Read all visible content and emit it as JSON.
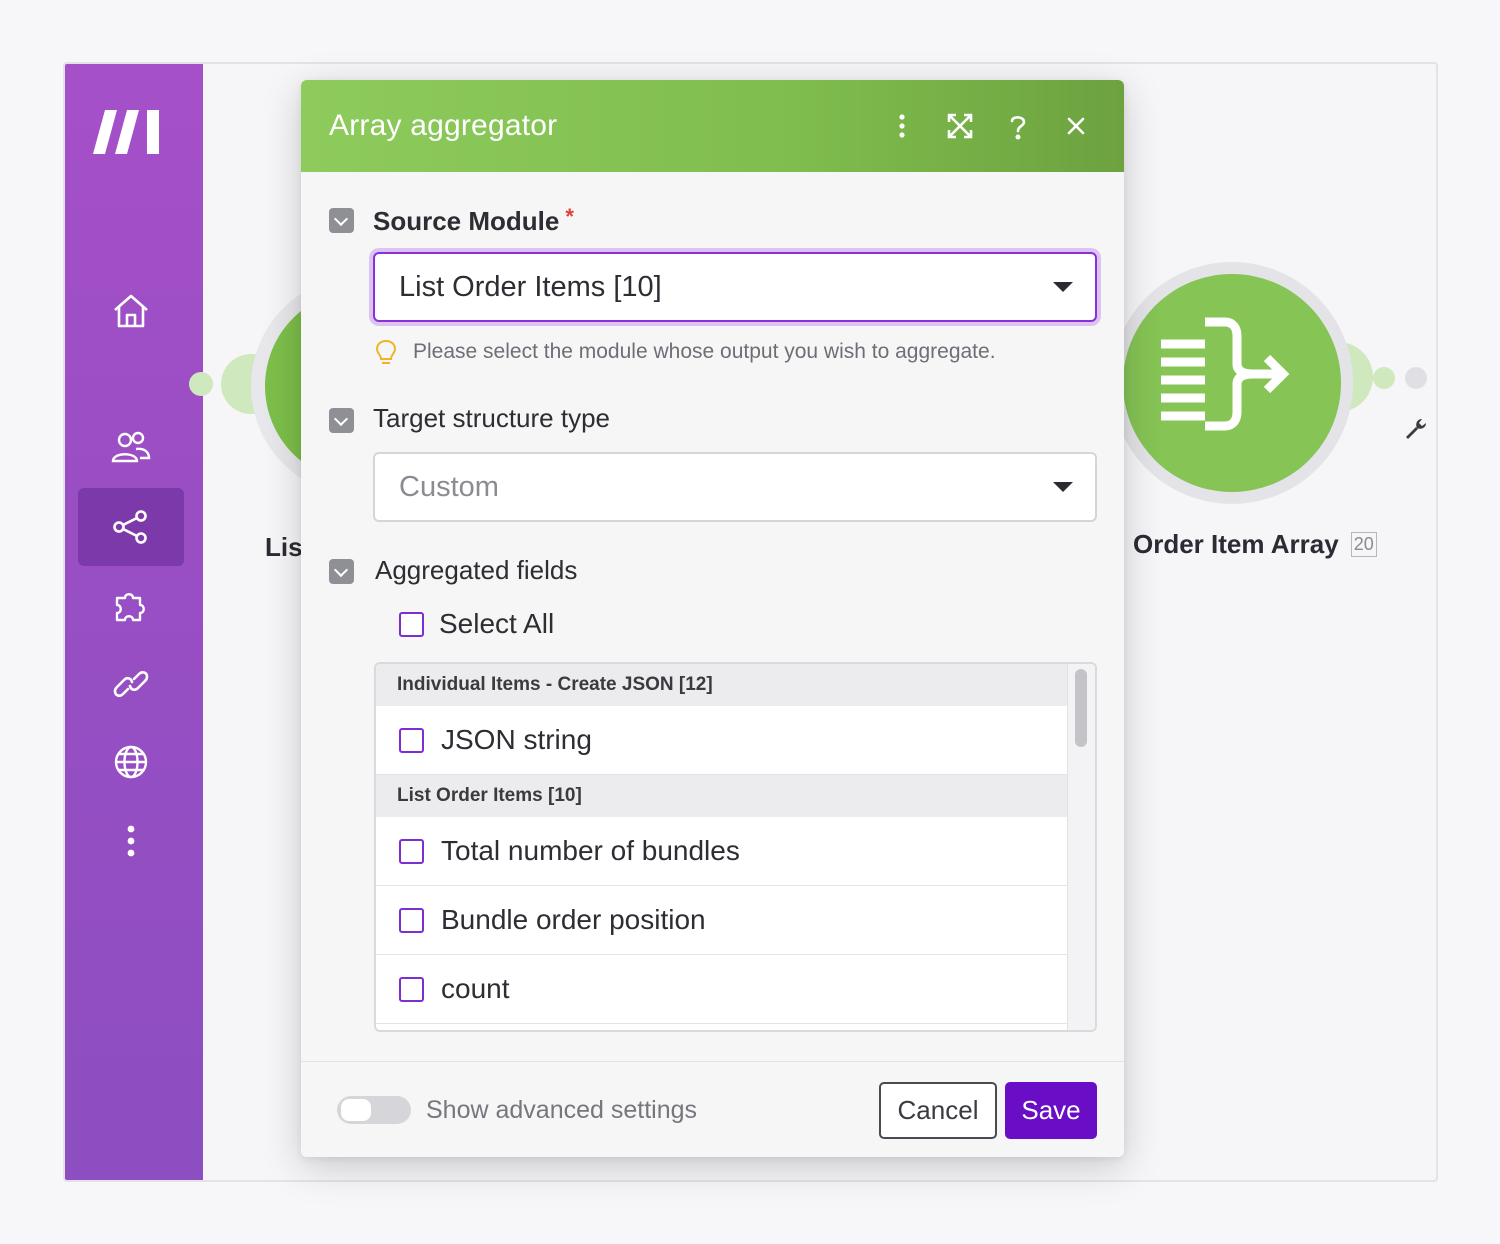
{
  "sidebar": {
    "items": [
      {
        "name": "home",
        "active": false
      },
      {
        "name": "teams",
        "active": false
      },
      {
        "name": "scenarios",
        "active": true
      },
      {
        "name": "apps",
        "active": false
      },
      {
        "name": "connections",
        "active": false
      },
      {
        "name": "webhooks",
        "active": false
      },
      {
        "name": "more",
        "active": false
      }
    ]
  },
  "canvas": {
    "left_module_label": "Lis",
    "right_module_label": "Order Item Array",
    "right_module_id": "20"
  },
  "dialog": {
    "title": "Array aggregator",
    "source_module": {
      "label": "Source Module",
      "required_mark": "*",
      "value": "List Order Items [10]",
      "hint": "Please select the module whose output you wish to aggregate."
    },
    "target_structure": {
      "label": "Target structure type",
      "value": "Custom"
    },
    "aggregated_fields": {
      "label": "Aggregated fields",
      "select_all": "Select All",
      "groups": [
        {
          "title": "Individual Items - Create JSON [12]",
          "items": [
            "JSON string"
          ]
        },
        {
          "title": "List Order Items [10]",
          "items": [
            "Total number of bundles",
            "Bundle order position",
            "count"
          ]
        }
      ]
    },
    "footer": {
      "advanced_label": "Show advanced settings",
      "cancel": "Cancel",
      "save": "Save"
    }
  },
  "colors": {
    "sidebar": "#9a4ec4",
    "header_green": "#7fbd4e",
    "accent_purple": "#6a0dc7",
    "required_red": "#e0413b"
  }
}
